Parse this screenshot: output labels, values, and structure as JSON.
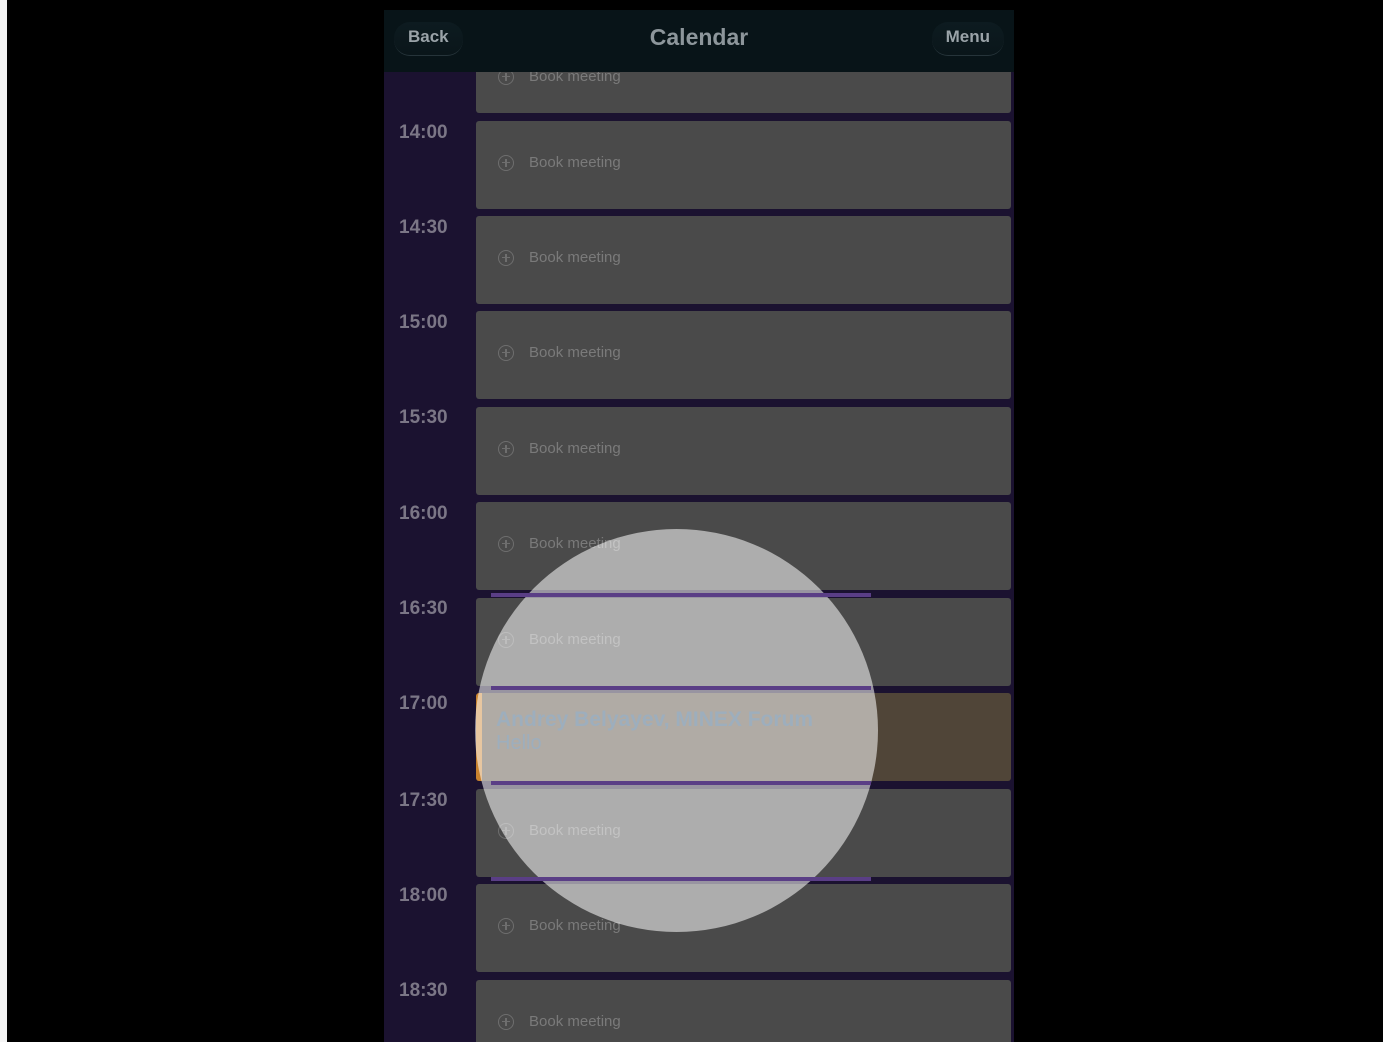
{
  "header": {
    "back_label": "Back",
    "title": "Calendar",
    "menu_label": "Menu"
  },
  "slot_label": "Book meeting",
  "times": [
    "14:00",
    "14:30",
    "15:00",
    "15:30",
    "16:00",
    "16:30",
    "17:00",
    "17:30",
    "18:00",
    "18:30"
  ],
  "event": {
    "title": "Andrey Belyayev, MINEX Forum",
    "subtitle": "Hello"
  },
  "colors": {
    "header_bg": "#081418",
    "sidebar_bg": "#1b1230",
    "slot_bg": "#4a4a4a",
    "event_accent": "#c9822e",
    "event_text": "#274c6e"
  }
}
